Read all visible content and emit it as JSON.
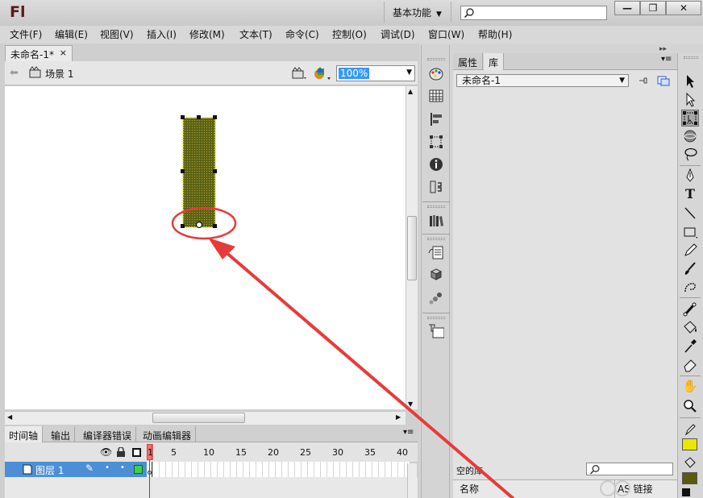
{
  "app": {
    "logo": "Fl",
    "workspace": "基本功能"
  },
  "window_controls": {
    "minimize": "—",
    "restore": "❐",
    "close": "✕"
  },
  "menu": [
    "文件(F)",
    "编辑(E)",
    "视图(V)",
    "插入(I)",
    "修改(M)",
    "文本(T)",
    "命令(C)",
    "控制(O)",
    "调试(D)",
    "窗口(W)",
    "帮助(H)"
  ],
  "document": {
    "tab_title": "未命名-1*",
    "close": "×"
  },
  "editbar": {
    "scene_label": "场景 1",
    "zoom": "100%"
  },
  "timeline": {
    "tabs": [
      "时间轴",
      "输出",
      "编译器错误",
      "动画编辑器"
    ],
    "ruler_labels": [
      "1",
      "5",
      "10",
      "15",
      "20",
      "25",
      "30",
      "35",
      "40"
    ],
    "layer_name": "图层 1"
  },
  "panel": {
    "tabs": [
      "属性",
      "库"
    ],
    "library_name": "未命名-1",
    "empty_library": "空的库",
    "columns": {
      "name": "名称",
      "linkage": "AS 链接"
    }
  },
  "stage": {
    "shape_fill": "#5d6313",
    "shape_border": "#e7e03a",
    "annotation_color": "#e83a3a"
  },
  "tools": {
    "stroke_color": "#e8e800",
    "fill_color": "#5a5a10"
  }
}
